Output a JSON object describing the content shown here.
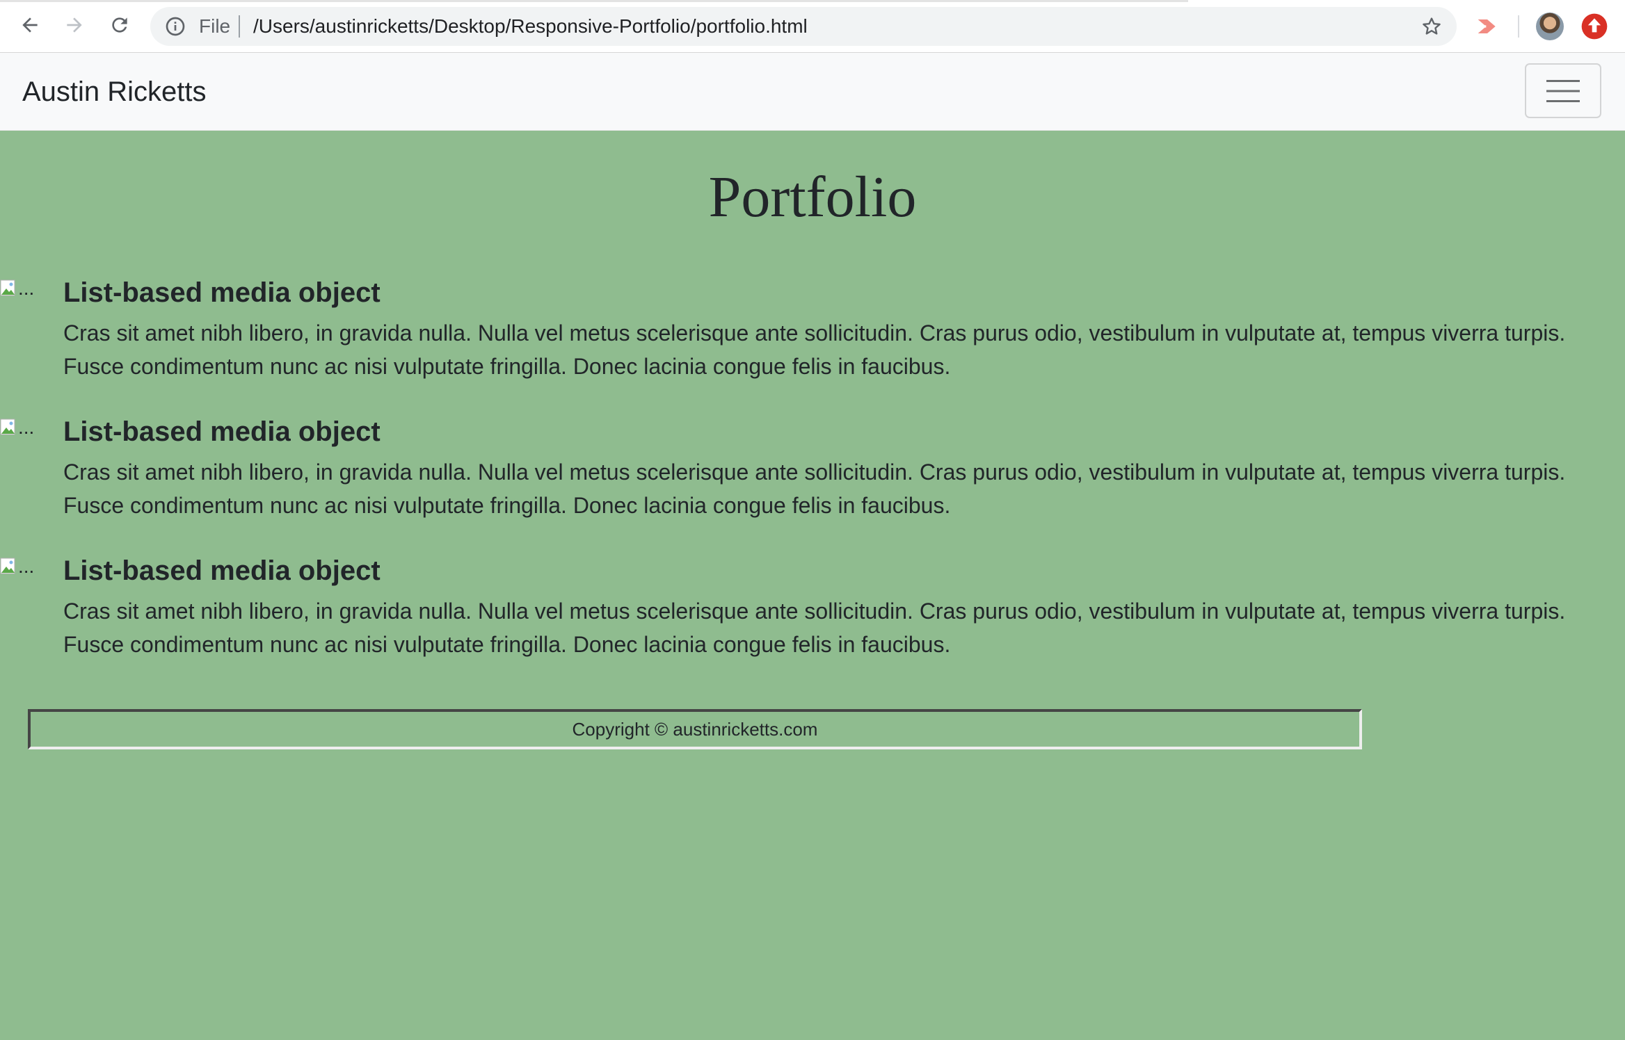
{
  "browser": {
    "scheme_label": "File",
    "url": "/Users/austinricketts/Desktop/Responsive-Portfolio/portfolio.html",
    "icons": [
      "back-icon",
      "forward-icon",
      "reload-icon",
      "info-icon",
      "star-icon",
      "share-extension-icon",
      "profile-avatar",
      "upload-extension-icon"
    ],
    "colors": {
      "chrome_bg": "#ffffff",
      "omnibox_bg": "#f1f3f4",
      "extension_red": "#d93025",
      "share_pink": "#f28b82"
    }
  },
  "navbar": {
    "brand": "Austin Ricketts",
    "toggler_icon": "hamburger-icon"
  },
  "main": {
    "title": "Portfolio",
    "media_items": [
      {
        "img_alt": "...",
        "heading": "List-based media object",
        "text": "Cras sit amet nibh libero, in gravida nulla. Nulla vel metus scelerisque ante sollicitudin. Cras purus odio, vestibulum in vulputate at, tempus viverra turpis. Fusce condimentum nunc ac nisi vulputate fringilla. Donec lacinia congue felis in faucibus."
      },
      {
        "img_alt": "...",
        "heading": "List-based media object",
        "text": "Cras sit amet nibh libero, in gravida nulla. Nulla vel metus scelerisque ante sollicitudin. Cras purus odio, vestibulum in vulputate at, tempus viverra turpis. Fusce condimentum nunc ac nisi vulputate fringilla. Donec lacinia congue felis in faucibus."
      },
      {
        "img_alt": "...",
        "heading": "List-based media object",
        "text": "Cras sit amet nibh libero, in gravida nulla. Nulla vel metus scelerisque ante sollicitudin. Cras purus odio, vestibulum in vulputate at, tempus viverra turpis. Fusce condimentum nunc ac nisi vulputate fringilla. Donec lacinia congue felis in faucibus."
      }
    ]
  },
  "footer": {
    "text": "Copyright © austinricketts.com"
  },
  "theme": {
    "page_bg": "#8fbc8f",
    "navbar_bg": "#f8f9fa",
    "text_color": "#212529"
  }
}
